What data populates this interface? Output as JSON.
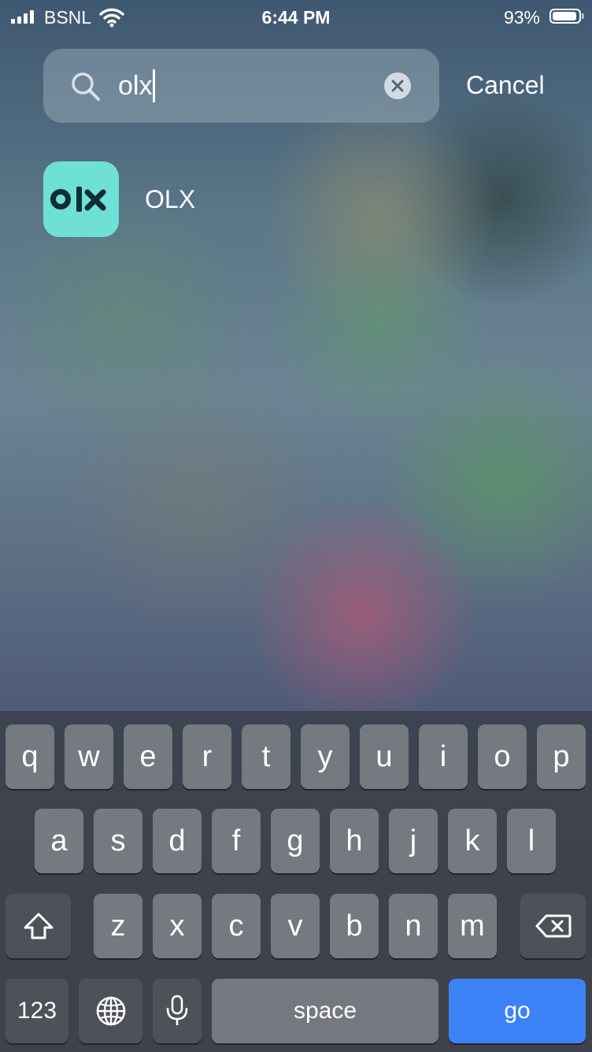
{
  "status_bar": {
    "carrier": "BSNL",
    "time": "6:44 PM",
    "battery_percent": "93%",
    "battery_level": 0.93,
    "signal_bars": 4
  },
  "search": {
    "value": "olx",
    "cancel_label": "Cancel",
    "clear_icon": "clear-circle-icon",
    "search_icon": "magnifier-icon"
  },
  "results": [
    {
      "app_name": "OLX",
      "icon_text": "olx",
      "icon_color": "#6ee0d5",
      "icon_fg": "#0e2f35"
    }
  ],
  "keyboard": {
    "row1": [
      "q",
      "w",
      "e",
      "r",
      "t",
      "y",
      "u",
      "i",
      "o",
      "p"
    ],
    "row2": [
      "a",
      "s",
      "d",
      "f",
      "g",
      "h",
      "j",
      "k",
      "l"
    ],
    "row3": [
      "z",
      "x",
      "c",
      "v",
      "b",
      "n",
      "m"
    ],
    "numbers_label": "123",
    "space_label": "space",
    "go_label": "go",
    "go_color": "#3b82f6",
    "shift_icon": "shift-arrow-icon",
    "delete_icon": "backspace-icon",
    "globe_icon": "globe-icon",
    "mic_icon": "microphone-icon"
  }
}
